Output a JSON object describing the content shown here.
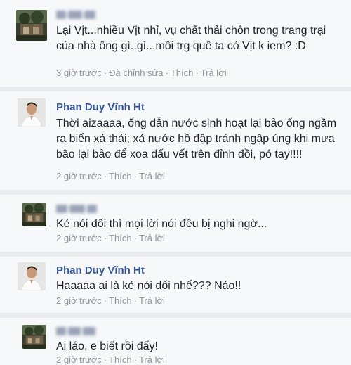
{
  "comments": [
    {
      "author": "",
      "avatar": "landscape-photo",
      "text": "Lại Vịt...nhiều Vịt nhỉ, vụ chất thải chôn trong trang trại của nhà ông gì..gì...môi trg quê ta có Vịt k iem? :D",
      "time": "3 giờ trước",
      "edited": "Đã chỉnh sửa",
      "like": "Thích",
      "reply": "Trả lời"
    },
    {
      "author": "Phan Duy Vĩnh Ht",
      "avatar": "person-white-shirt",
      "text": "Thời aizaaaa, ống dẫn nước sinh hoạt lại bảo ống ngầm ra biển xả thải; xả nước hồ đập tránh ngập úng khi mưa bão lại bảo để xoa dấu vết trên đỉnh đồi, pó tay!!!!",
      "time": "2 giờ trước",
      "like": "Thích",
      "reply": "Trả lời"
    },
    {
      "author": "",
      "avatar": "landscape-photo",
      "text": "Kẻ nói dối thì mọi lời nói đều bị nghi ngờ...",
      "time": "2 giờ trước",
      "like": "Thích",
      "reply": "Trả lời"
    },
    {
      "author": "Phan Duy Vĩnh Ht",
      "avatar": "person-white-shirt",
      "text": "Haaaaa ai là kẻ nói dối nhể??? Náo!!",
      "time": "2 giờ trước",
      "like": "Thích",
      "reply": "Trả lời"
    },
    {
      "author": "",
      "avatar": "landscape-photo",
      "text": "Ai láo, e biết rồi đấy!",
      "time": "2 giờ trước",
      "like": "Thích",
      "reply": "Trả lời"
    }
  ],
  "colors": {
    "background": "#e9ebee",
    "card": "#f7f8fa",
    "author_link": "#365899",
    "meta": "#90949c"
  }
}
